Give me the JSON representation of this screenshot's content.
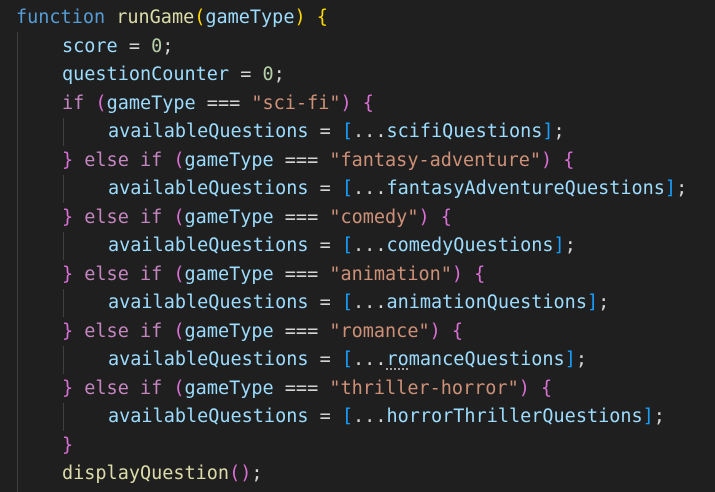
{
  "code": {
    "kw_function": "function",
    "fn_name": "runGame",
    "param": "gameType",
    "open_paren": "(",
    "close_paren": ")",
    "open_brace": "{",
    "close_brace": "}",
    "score_var": "score",
    "counter_var": "questionCounter",
    "assign": " = ",
    "zero": "0",
    "semi": ";",
    "kw_if": "if",
    "kw_else": "else",
    "strict_eq": " === ",
    "target": "availableQuestions",
    "spread": "...",
    "open_bracket": "[",
    "close_bracket": "]",
    "branches": [
      {
        "genre": "\"sci-fi\"",
        "array": "scifiQuestions"
      },
      {
        "genre": "\"fantasy-adventure\"",
        "array": "fantasyAdventureQuestions"
      },
      {
        "genre": "\"comedy\"",
        "array": "comedyQuestions"
      },
      {
        "genre": "\"animation\"",
        "array": "animationQuestions"
      },
      {
        "genre": "\"romance\"",
        "array": "romanceQuestions"
      },
      {
        "genre": "\"thriller-horror\"",
        "array": "horrorThrillerQuestions"
      }
    ],
    "display_fn": "displayQuestion",
    "romance_prefix": "ro",
    "romance_rest": "manceQuestions"
  }
}
